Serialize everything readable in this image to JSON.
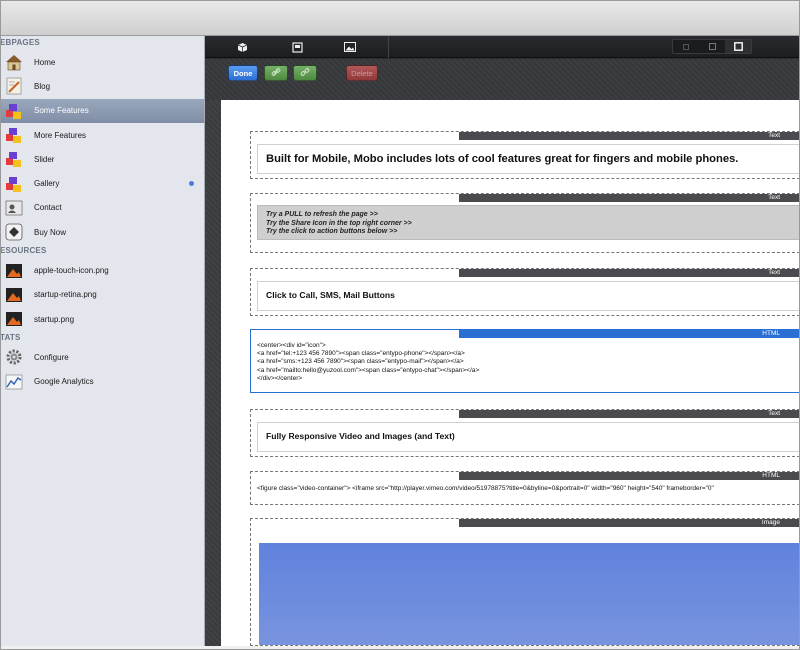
{
  "sidebar": {
    "sections": [
      {
        "title": "EBPAGES",
        "items": [
          {
            "label": "Home",
            "icon": "home-icon"
          },
          {
            "label": "Blog",
            "icon": "blog-icon"
          },
          {
            "label": "Some Features",
            "icon": "cubes-icon",
            "selected": true
          },
          {
            "label": "More Features",
            "icon": "cubes-icon"
          },
          {
            "label": "Slider",
            "icon": "cubes-icon"
          },
          {
            "label": "Gallery",
            "icon": "cubes-icon",
            "dot": true
          },
          {
            "label": "Contact",
            "icon": "contact-icon"
          },
          {
            "label": "Buy Now",
            "icon": "buy-icon"
          }
        ]
      },
      {
        "title": "ESOURCES",
        "items": [
          {
            "label": "apple-touch-icon.png",
            "icon": "image-file-icon"
          },
          {
            "label": "startup-retina.png",
            "icon": "image-file-icon"
          },
          {
            "label": "startup.png",
            "icon": "image-file-icon"
          }
        ]
      },
      {
        "title": "TATS",
        "items": [
          {
            "label": "Configure",
            "icon": "gear-icon"
          },
          {
            "label": "Google Analytics",
            "icon": "analytics-icon"
          }
        ]
      }
    ]
  },
  "toolbar": {
    "done_label": "Done",
    "delete_label": "Delete"
  },
  "blocks": {
    "b1": {
      "tab": "Text",
      "text": "Built for Mobile, Mobo includes lots of cool features great for fingers and mobile phones."
    },
    "b2": {
      "tab": "Text",
      "text": "Try a PULL to refresh the page >>\nTry the Share Icon in the top right corner >>\nTry the click to action buttons below >>"
    },
    "b3": {
      "tab": "Text",
      "text": "Click to Call, SMS, Mail Buttons"
    },
    "b4": {
      "tab": "HTML",
      "text": "<center><div id=\"icon\">\n<a href=\"tel:+123 456 7890\"><span class=\"entypo-phone\"></span></a>\n<a href=\"sms:+123 456 7890\"><span class=\"entypo-mail\"></span></a>\n<a href=\"mailto:hello@yuzool.com\"><span class=\"entypo-chat\"></span></a>\n</div></center>"
    },
    "b5": {
      "tab": "Text",
      "text": "Fully Responsive Video and Images (and Text)"
    },
    "b6": {
      "tab": "HTML",
      "text": "<figure class=\"video-container\"> <iframe src=\"http://player.vimeo.com/video/51978875?title=0&byline=0&portrait=0\" width=\"960\" height=\"540\" frameborder=\"0\""
    },
    "b7": {
      "tab": "Image"
    }
  },
  "colors": {
    "accent": "#2a6fd4",
    "selected_sidebar": "#8e9cb3",
    "done_button": "#2c6fd6",
    "link_button": "#4d8a40",
    "delete_button": "#a83a3a",
    "image_fill": "#6b8be0"
  }
}
